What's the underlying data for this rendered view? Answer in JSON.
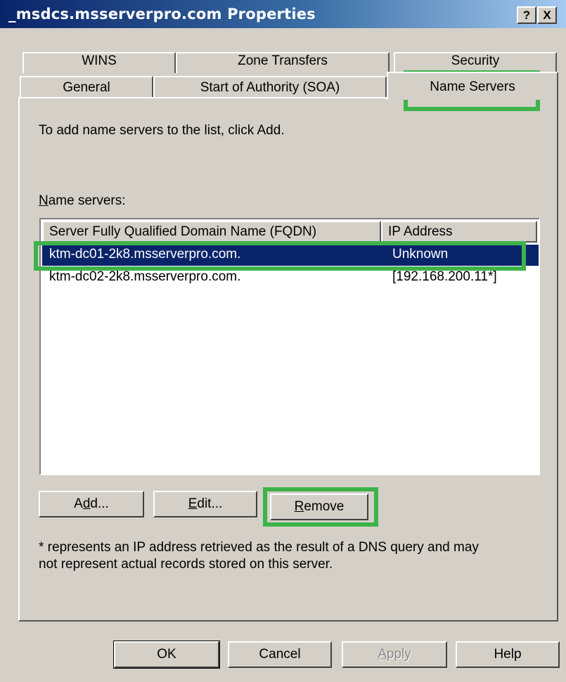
{
  "window": {
    "title": "_msdcs.msserverpro.com Properties",
    "help_button": "?",
    "close_button": "X"
  },
  "tabs": {
    "back_row": [
      "WINS",
      "Zone Transfers",
      "Security"
    ],
    "front_row": [
      "General",
      "Start of Authority (SOA)",
      "Name Servers"
    ],
    "active": "Name Servers"
  },
  "panel": {
    "instruction": "To add name servers to the list, click Add.",
    "list_label": "Name servers:",
    "list_label_mnemonic": "N",
    "columns": [
      "Server Fully Qualified Domain Name (FQDN)",
      "IP Address"
    ],
    "rows": [
      {
        "fqdn": "ktm-dc01-2k8.msserverpro.com.",
        "ip": "Unknown",
        "selected": true
      },
      {
        "fqdn": "ktm-dc02-2k8.msserverpro.com.",
        "ip": "[192.168.200.11*]",
        "selected": false
      }
    ],
    "buttons": {
      "add": {
        "label": "Add...",
        "mnemonic": "d"
      },
      "edit": {
        "label": "Edit...",
        "mnemonic": "E"
      },
      "remove": {
        "label": "Remove",
        "mnemonic": "R"
      }
    },
    "footnote_line1": "* represents an IP address retrieved as the result of a DNS query and may",
    "footnote_line2": "not represent actual records stored on this server."
  },
  "dialog_buttons": {
    "ok": "OK",
    "cancel": "Cancel",
    "apply": "Apply",
    "help": "Help"
  },
  "colors": {
    "highlight": "#3db34a",
    "selection": "#0a246a",
    "face": "#d4d0c8"
  }
}
